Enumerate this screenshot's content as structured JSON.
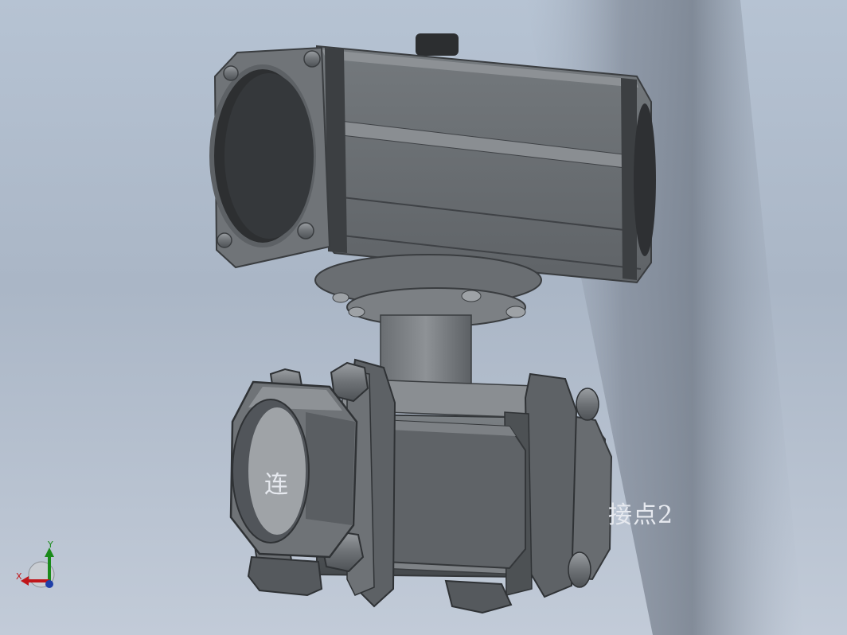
{
  "viewport": {
    "annotation_left": "连",
    "annotation_right": "接点2"
  },
  "triad": {
    "x_label": "X",
    "y_label": "Y",
    "x_color": "#c0161a",
    "y_color": "#1a8a1a",
    "z_color": "#1f3fa8"
  },
  "colors": {
    "background_top": "#b6c3d3",
    "body_dark": "#55595d",
    "body_mid": "#6b7074",
    "body_light": "#9a9ea2",
    "cap_black": "#2c2e30"
  }
}
